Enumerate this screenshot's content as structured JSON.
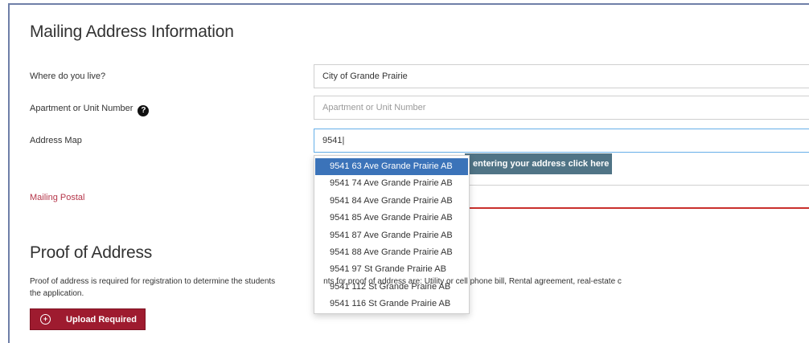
{
  "mailing": {
    "title": "Mailing Address Information",
    "where_label": "Where do you live?",
    "where_value": "City of Grande Prairie",
    "unit_label": "Apartment or Unit Number",
    "unit_placeholder": "Apartment or Unit Number",
    "address_map_label": "Address Map",
    "address_map_value": "9541|",
    "hint_button": "entering your address click here",
    "postal_label": "Mailing Postal"
  },
  "suggestions": [
    "9541 63 Ave Grande Prairie AB",
    "9541 74 Ave Grande Prairie AB",
    "9541 84 Ave Grande Prairie AB",
    "9541 85 Ave Grande Prairie AB",
    "9541 87 Ave Grande Prairie AB",
    "9541 88 Ave Grande Prairie AB",
    "9541 97 St Grande Prairie AB",
    "9541 112 St Grande Prairie AB",
    "9541 116 St Grande Prairie AB"
  ],
  "proof": {
    "title": "Proof of Address",
    "para_line1_left": "Proof of address is required for registration to determine the students",
    "para_line1_right": "nts for proof of address are: Utility or cell phone bill, Rental agreement, real-estate c",
    "para_line2": "the application.",
    "upload_button": "Upload Required"
  },
  "icons": {
    "help": "question-circle-icon",
    "upload": "plus-circle-icon"
  },
  "colors": {
    "upload_button": "#9e1b2f",
    "hint_button": "#507486",
    "active_suggestion": "#3b73b9",
    "error_text": "#b5364a"
  }
}
